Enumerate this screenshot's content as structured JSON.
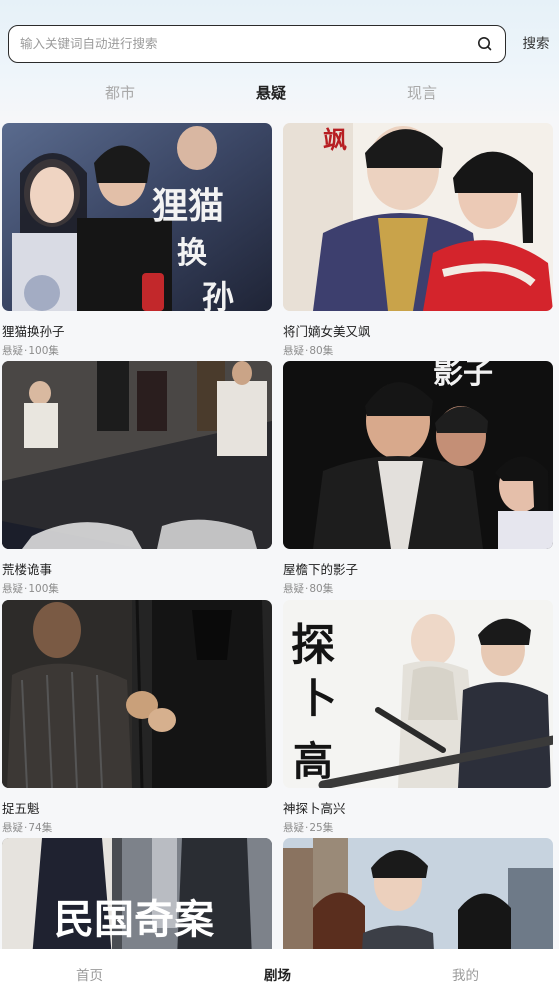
{
  "search": {
    "placeholder": "输入关键词自动进行搜索",
    "value": "",
    "button_label": "搜索"
  },
  "category_tabs": [
    {
      "label": "都市",
      "active": false
    },
    {
      "label": "悬疑",
      "active": true
    },
    {
      "label": "现言",
      "active": false
    }
  ],
  "dramas": [
    {
      "title": "狸猫换孙子",
      "genre": "悬疑",
      "separator": "·",
      "episodes": "100集",
      "poster_text": "狸猫换孙"
    },
    {
      "title": "将门嫡女美又飒",
      "genre": "悬疑",
      "separator": "·",
      "episodes": "80集",
      "poster_text": "飒"
    },
    {
      "title": "荒楼诡事",
      "genre": "悬疑",
      "separator": "·",
      "episodes": "100集",
      "poster_text": ""
    },
    {
      "title": "屋檐下的影子",
      "genre": "悬疑",
      "separator": "·",
      "episodes": "80集",
      "poster_text": "影子"
    },
    {
      "title": "捉五魁",
      "genre": "悬疑",
      "separator": "·",
      "episodes": "74集",
      "poster_text": ""
    },
    {
      "title": "神探卜高兴",
      "genre": "悬疑",
      "separator": "·",
      "episodes": "25集",
      "poster_text": "探卜高"
    },
    {
      "title": "",
      "genre": "",
      "separator": "",
      "episodes": "",
      "poster_text": "民国奇案"
    },
    {
      "title": "",
      "genre": "",
      "separator": "",
      "episodes": "",
      "poster_text": ""
    }
  ],
  "bottom_nav": [
    {
      "label": "首页",
      "icon": "home-icon",
      "active": false
    },
    {
      "label": "剧场",
      "icon": "theater-icon",
      "active": true
    },
    {
      "label": "我的",
      "icon": "profile-icon",
      "active": false
    }
  ],
  "colors": {
    "accent_text": "#222222",
    "inactive_text": "#a9a9a9",
    "meta_text": "#8c8c8c",
    "page_bg": "#f6f7f9"
  }
}
